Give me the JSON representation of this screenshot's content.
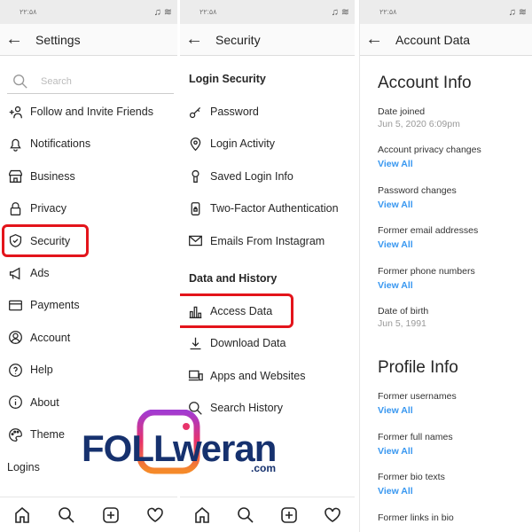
{
  "status": {
    "time": "۲۲:۵۸",
    "icons": "♫ ≋"
  },
  "settings": {
    "title": "Settings",
    "search_placeholder": "Search",
    "items": [
      "Follow and Invite Friends",
      "Notifications",
      "Business",
      "Privacy",
      "Security",
      "Ads",
      "Payments",
      "Account",
      "Help",
      "About",
      "Theme"
    ],
    "icons": [
      "add-person-icon",
      "bell-icon",
      "shop-icon",
      "lock-icon",
      "shield-icon",
      "megaphone-icon",
      "card-icon",
      "person-icon",
      "help-icon",
      "info-icon",
      "palette-icon"
    ],
    "logins_heading": "Logins",
    "highlight_color": "#e3141b"
  },
  "security": {
    "title": "Security",
    "login_security": "Login Security",
    "login_items": [
      "Password",
      "Login Activity",
      "Saved Login Info",
      "Two-Factor Authentication",
      "Emails From Instagram"
    ],
    "data_history": "Data and History",
    "data_items": [
      "Access Data",
      "Download Data",
      "Apps and Websites",
      "Search History"
    ]
  },
  "account_data": {
    "title": "Account Data",
    "account_info": "Account Info",
    "date_joined_label": "Date joined",
    "date_joined": "Jun 5, 2020 6:09pm",
    "account_items": [
      "Account privacy changes",
      "Password changes",
      "Former email addresses",
      "Former phone numbers"
    ],
    "dob_label": "Date of birth",
    "dob": "Jun 5, 1991",
    "profile_info": "Profile Info",
    "profile_items": [
      "Former usernames",
      "Former full names",
      "Former bio texts"
    ],
    "last_item": "Former links in bio",
    "view_all": "View All",
    "link_color": "#3897f0"
  },
  "watermark": {
    "text": "Followeran",
    "suffix": ".com"
  }
}
